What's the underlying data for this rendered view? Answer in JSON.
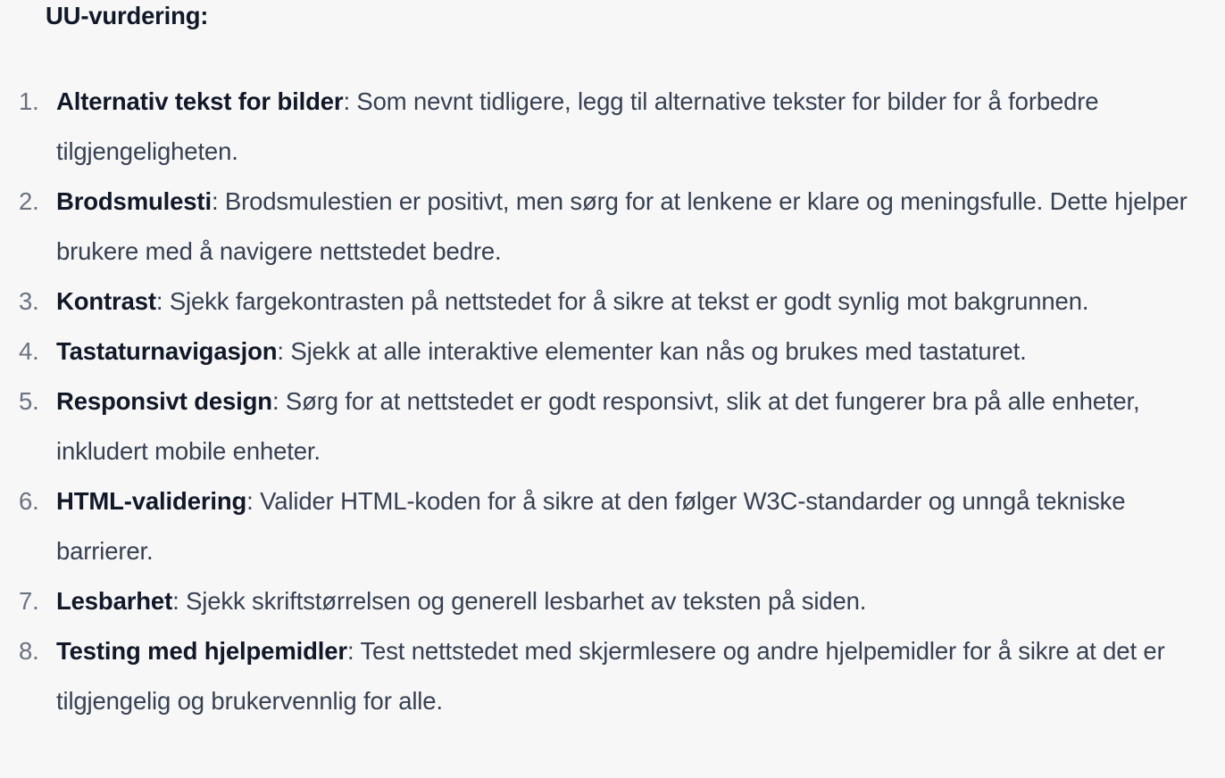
{
  "heading": "UU-vurdering:",
  "items": [
    {
      "number": "1.",
      "term": "Alternativ tekst for bilder",
      "text": ": Som nevnt tidligere, legg til alternative tekster for bilder for å forbedre tilgjengeligheten."
    },
    {
      "number": "2.",
      "term": "Brodsmulesti",
      "text": ": Brodsmulestien er positivt, men sørg for at lenkene er klare og meningsfulle. Dette hjelper brukere med å navigere nettstedet bedre."
    },
    {
      "number": "3.",
      "term": "Kontrast",
      "text": ": Sjekk fargekontrasten på nettstedet for å sikre at tekst er godt synlig mot bakgrunnen."
    },
    {
      "number": "4.",
      "term": "Tastaturnavigasjon",
      "text": ": Sjekk at alle interaktive elementer kan nås og brukes med tastaturet."
    },
    {
      "number": "5.",
      "term": "Responsivt design",
      "text": ": Sørg for at nettstedet er godt responsivt, slik at det fungerer bra på alle enheter, inkludert mobile enheter."
    },
    {
      "number": "6.",
      "term": "HTML-validering",
      "text": ": Valider HTML-koden for å sikre at den følger W3C-standarder og unngå tekniske barrierer."
    },
    {
      "number": "7.",
      "term": "Lesbarhet",
      "text": ": Sjekk skriftstørrelsen og generell lesbarhet av teksten på siden."
    },
    {
      "number": "8.",
      "term": "Testing med hjelpemidler",
      "text": ": Test nettstedet med skjermlesere og andre hjelpemidler for å sikre at det er tilgjengelig og brukervennlig for alle."
    }
  ],
  "colors": {
    "background": "#f7f7f8",
    "body_text": "#374151",
    "bold_text": "#111827",
    "list_number": "#6b7280"
  }
}
